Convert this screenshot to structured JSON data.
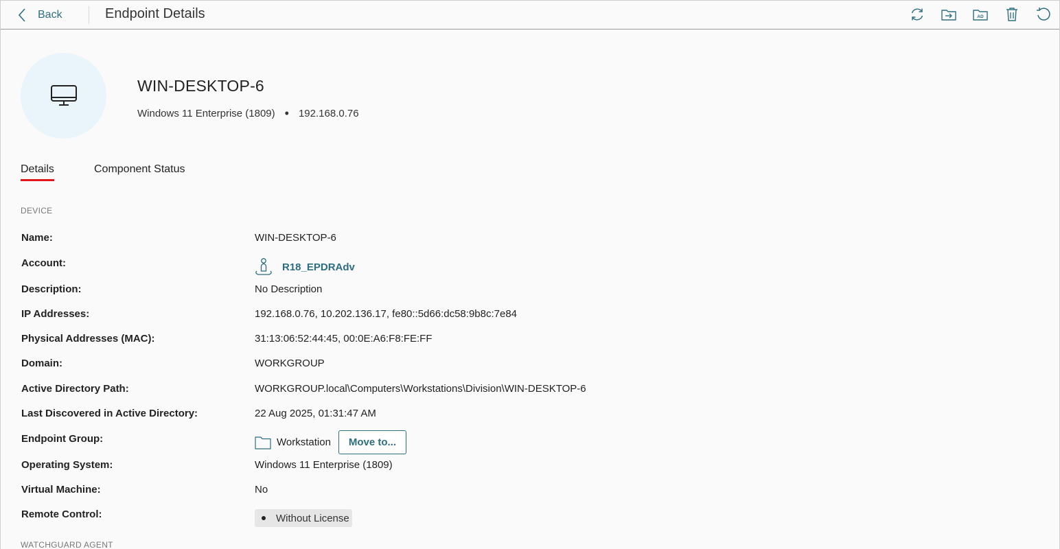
{
  "header": {
    "back_label": "Back",
    "title": "Endpoint Details",
    "toolbar": [
      {
        "icon": "sync-icon"
      },
      {
        "icon": "move-folder-icon"
      },
      {
        "icon": "active-directory-icon",
        "text": "AD"
      },
      {
        "icon": "trash-icon"
      },
      {
        "icon": "restart-icon"
      }
    ]
  },
  "endpoint": {
    "name": "WIN-DESKTOP-6",
    "os": "Windows 11 Enterprise (1809)",
    "separator": "•",
    "ip": "192.168.0.76",
    "icon": "desktop-monitor-icon"
  },
  "tabs": [
    {
      "label": "Details",
      "active": true
    },
    {
      "label": "Component Status",
      "active": false
    }
  ],
  "device_section": {
    "title": "DEVICE",
    "fields": {
      "name": {
        "label": "Name:",
        "value": "WIN-DESKTOP-6"
      },
      "account": {
        "label": "Account:",
        "value": "R18_EPDRAdv"
      },
      "description": {
        "label": "Description:",
        "value": "No Description"
      },
      "ip_addresses": {
        "label": "IP Addresses:",
        "value": "192.168.0.76, 10.202.136.17, fe80::5d66:dc58:9b8c:7e84"
      },
      "mac": {
        "label": "Physical Addresses (MAC):",
        "value": "31:13:06:52:44:45, 00:0E:A6:F8:FE:FF"
      },
      "domain": {
        "label": "Domain:",
        "value": "WORKGROUP"
      },
      "ad_path": {
        "label": "Active Directory Path:",
        "value": "WORKGROUP.local\\Computers\\Workstations\\Division\\WIN-DESKTOP-6"
      },
      "last_discovered": {
        "label": "Last Discovered in Active Directory:",
        "value": "22 Aug 2025, 01:31:47 AM"
      },
      "endpoint_group": {
        "label": "Endpoint Group:",
        "value": "Workstation",
        "button": "Move to..."
      },
      "os": {
        "label": "Operating System:",
        "value": "Windows 11 Enterprise (1809)"
      },
      "virtual_machine": {
        "label": "Virtual Machine:",
        "value": "No"
      },
      "remote_control": {
        "label": "Remote Control:",
        "value": "Without License"
      }
    }
  },
  "agent_section": {
    "title": "WATCHGUARD AGENT"
  },
  "colors": {
    "accent": "#2c6e7e",
    "tab_underline": "#e0161b",
    "avatar_bg": "#e9f5fb"
  }
}
